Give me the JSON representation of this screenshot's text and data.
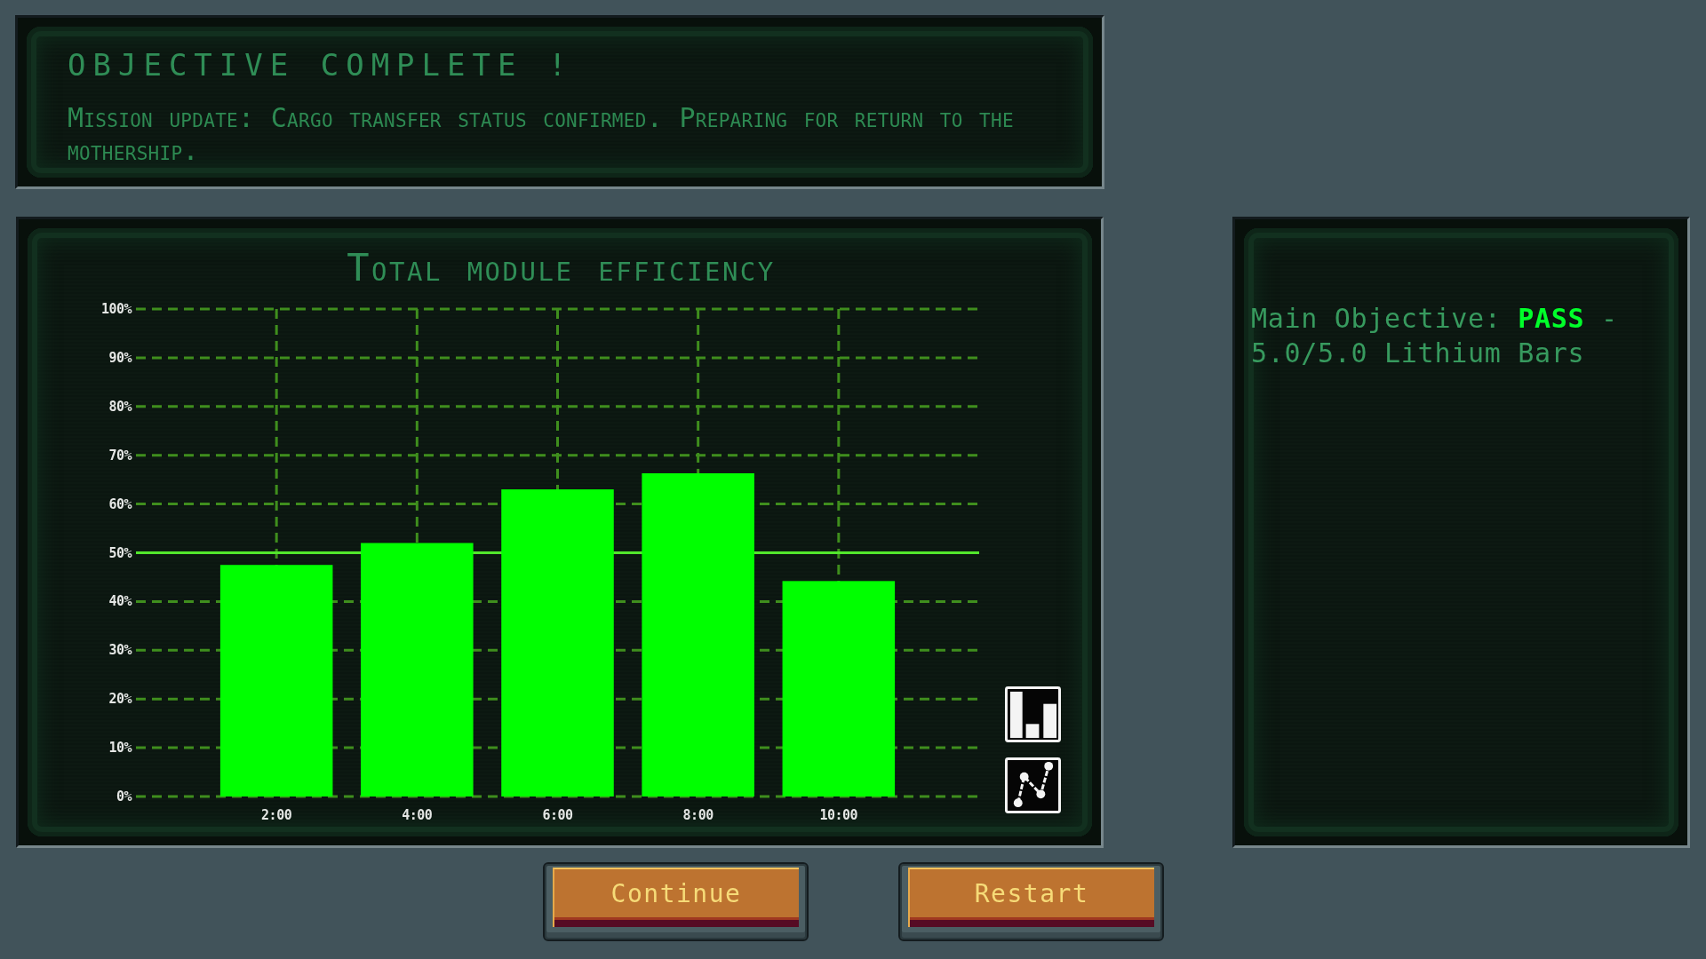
{
  "objective_banner": {
    "title": "OBJECTIVE COMPLETE !",
    "message": "Mission update: Cargo transfer status confirmed. Preparing for return to the mothership."
  },
  "efficiency_panel": {
    "chart_data": {
      "type": "bar",
      "title": "Total module efficiency",
      "x": [
        2,
        4,
        6,
        8,
        10
      ],
      "values": [
        47.5,
        52,
        63,
        66.3,
        44.2
      ],
      "xlim": [
        0,
        12
      ],
      "ylim": [
        0,
        100
      ],
      "xticks": [
        {
          "value": 2,
          "label": "2:00"
        },
        {
          "value": 4,
          "label": "4:00"
        },
        {
          "value": 6,
          "label": "6:00"
        },
        {
          "value": 8,
          "label": "8:00"
        },
        {
          "value": 10,
          "label": "10:00"
        }
      ],
      "yticks": [
        {
          "value": 0,
          "label": "0%"
        },
        {
          "value": 10,
          "label": "10%"
        },
        {
          "value": 20,
          "label": "20%"
        },
        {
          "value": 30,
          "label": "30%"
        },
        {
          "value": 40,
          "label": "40%"
        },
        {
          "value": 50,
          "label": "50%"
        },
        {
          "value": 60,
          "label": "60%"
        },
        {
          "value": 70,
          "label": "70%"
        },
        {
          "value": 80,
          "label": "80%"
        },
        {
          "value": 90,
          "label": "90%"
        },
        {
          "value": 100,
          "label": "100%"
        }
      ],
      "grid": true,
      "ref_lines": [
        {
          "axis": "y",
          "value": 50
        }
      ]
    }
  },
  "objectives_panel": {
    "lines": [
      "Main Objective: **PASS** - 5.0/5.0 Lithium Bars"
    ]
  },
  "buttons": [
    {
      "label": "Continue"
    },
    {
      "label": "Restart"
    }
  ]
}
